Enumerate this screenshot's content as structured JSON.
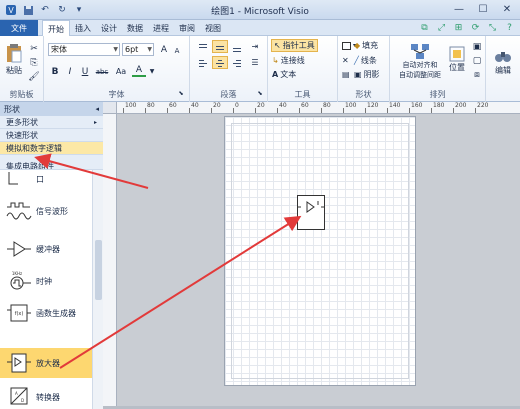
{
  "window": {
    "title": "绘图1 - Microsoft Visio",
    "min": "—",
    "max": "☐",
    "close": "✕"
  },
  "qat": {
    "save": "💾",
    "undo": "↶",
    "redo": "↻",
    "more": "▾"
  },
  "tabs": {
    "file": "文件",
    "items": [
      "开始",
      "插入",
      "设计",
      "数据",
      "进程",
      "审阅",
      "视图"
    ],
    "active": "开始"
  },
  "ribbon": {
    "clipboard": {
      "label": "剪贴板",
      "paste": "粘贴"
    },
    "font": {
      "label": "字体",
      "font_name": "宋体",
      "font_size": "6pt",
      "bold": "B",
      "italic": "I",
      "underline": "U",
      "strike": "abc",
      "case": "Aa",
      "color": "A",
      "grow": "A",
      "shrink": "A"
    },
    "paragraph": {
      "label": "段落"
    },
    "tools": {
      "label": "工具",
      "pointer": "指针工具",
      "connector": "连接线",
      "text": "文本"
    },
    "shape": {
      "label": "形状",
      "fill": "填充",
      "line": "线条",
      "shadow": "阴影"
    },
    "arrange": {
      "label": "排列",
      "auto_align": "自动对齐和",
      "auto_align2": "自动调整间距",
      "position": "位置"
    },
    "editing": {
      "label": "编辑"
    }
  },
  "shapes_pane": {
    "header": "形状",
    "menu": [
      {
        "label": "更多形状",
        "arrow": "▸"
      },
      {
        "label": "快速形状",
        "arrow": ""
      },
      {
        "label": "模拟和数字逻辑",
        "arrow": ""
      },
      {
        "label": "集成电路组件",
        "arrow": ""
      }
    ],
    "items": [
      {
        "label": "口"
      },
      {
        "label": "信号波形"
      },
      {
        "label": "缓冲器"
      },
      {
        "label": "时钟"
      },
      {
        "label": "函数生成器"
      },
      {
        "label": "放大器"
      },
      {
        "label": "转换器"
      }
    ],
    "selected_item": "放大器"
  },
  "ruler": {
    "ticks": [
      "100",
      "80",
      "60",
      "40",
      "20",
      "0",
      "20",
      "40",
      "60",
      "80",
      "100",
      "120",
      "140",
      "160",
      "180",
      "200",
      "220"
    ]
  },
  "colors": {
    "accent": "#2a64b0",
    "selected": "#fdd770",
    "arrow": "#e23a3a"
  }
}
